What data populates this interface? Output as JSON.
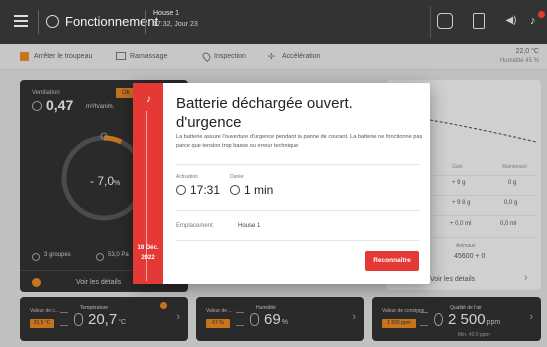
{
  "topbar": {
    "title": "Fonctionnement",
    "house": "House 1",
    "time_day": "17:32, Jour 23"
  },
  "toolbar": {
    "stop_flock": "Arrêter le troupeau",
    "ramassage": "Ramassage",
    "inspection": "Inspection",
    "acceleration": "Accélération",
    "temperature": "22,0 °C",
    "humidity": "Humidité 45 %"
  },
  "ventilation": {
    "label": "Ventilation",
    "value": "0,47",
    "unit": "m³/h/anim.",
    "badge": "Ok",
    "gauge_value": "7,0",
    "gauge_unit": "%",
    "groups": "3 groupes",
    "speed": "53,0 Pa",
    "details": "Voir les détails"
  },
  "right_card": {
    "col1": "Gain",
    "col2": "Maintenant",
    "rows": [
      {
        "a": "+ 9 g",
        "b": "0 g"
      },
      {
        "a": "+ 9 8 g",
        "b": "0,0 g"
      },
      {
        "a": "+ 0,0 ml",
        "b": "0,0 ml"
      }
    ],
    "extra_label": "Animaux",
    "extra_value": "45600 + 0",
    "details": "Voir les détails"
  },
  "bottom_cards": [
    {
      "label": "Valeur de c...",
      "badge": "20,5 °C",
      "name": "Température",
      "value": "20,7",
      "unit": "°C",
      "sub": ""
    },
    {
      "label": "Valeur de ...",
      "badge": "67 %",
      "name": "Humidité",
      "value": "69",
      "unit": "%",
      "sub": ""
    },
    {
      "label": "Valeur de consigne",
      "badge": "1 500 ppm",
      "name": "Qualité de l'air",
      "value": "2 500",
      "unit": "ppm",
      "sub": "Min. 40,0 ppm"
    }
  ],
  "modal": {
    "title": "Batterie déchargée ouvert. d'urgence",
    "description": "La batterie assure l'ouverture d'urgence pendant la panne de courant. La batterie ne fonctionne pas parce que tension trop basse ou erreur technique",
    "activation_label": "Activation",
    "activation_value": "17:31",
    "duration_label": "Durée",
    "duration_value": "1 min",
    "location_label": "Emplacement",
    "location_value": "House 1",
    "date_day": "18 Déc.",
    "date_year": "2022",
    "acknowledge": "Reconnaître"
  },
  "colors": {
    "accent_orange": "#f28a1c",
    "alarm_red": "#e53935",
    "dark_card": "#2b2b2b",
    "topbar": "#333333"
  },
  "icons": [
    "menu-icon",
    "house-icon",
    "home-icon",
    "document-icon",
    "speaker-icon",
    "alarm-bell-icon",
    "fan-icon",
    "thermometer-icon",
    "humidity-icon",
    "air-quality-icon",
    "clock-icon"
  ]
}
